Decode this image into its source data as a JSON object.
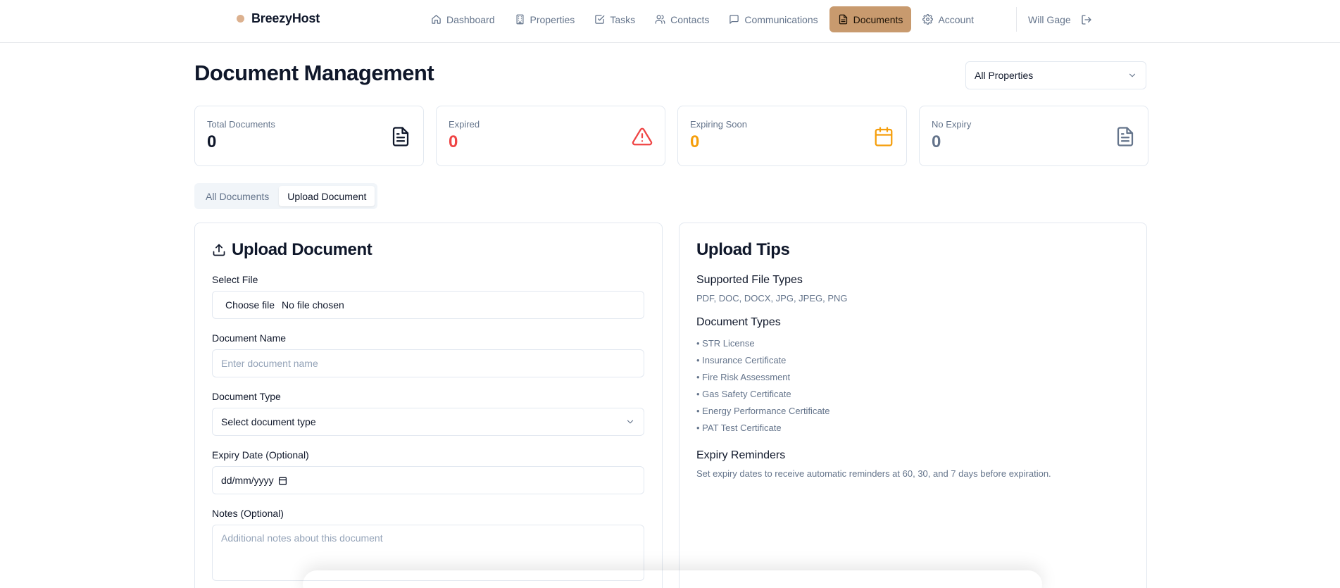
{
  "header": {
    "brand": "BreezyHost",
    "brand_color": "#dcb18f",
    "nav": [
      {
        "label": "Dashboard",
        "icon": "home-icon"
      },
      {
        "label": "Properties",
        "icon": "building-icon"
      },
      {
        "label": "Tasks",
        "icon": "check-square-icon"
      },
      {
        "label": "Contacts",
        "icon": "users-icon"
      },
      {
        "label": "Communications",
        "icon": "message-icon"
      },
      {
        "label": "Documents",
        "icon": "file-icon",
        "active": true
      },
      {
        "label": "Account",
        "icon": "gear-icon"
      }
    ],
    "user_name": "Will Gage",
    "active_color": "#c89a6e"
  },
  "page": {
    "title": "Document Management",
    "property_filter": "All Properties"
  },
  "stats": [
    {
      "label": "Total Documents",
      "value": "0",
      "color": "#0f172a",
      "icon": "file-text-icon"
    },
    {
      "label": "Expired",
      "value": "0",
      "color": "#ef4444",
      "icon": "alert-triangle-icon"
    },
    {
      "label": "Expiring Soon",
      "value": "0",
      "color": "#f59e0b",
      "icon": "calendar-icon"
    },
    {
      "label": "No Expiry",
      "value": "0",
      "color": "#64748b",
      "icon": "file-text-icon"
    }
  ],
  "tabs": [
    {
      "label": "All Documents"
    },
    {
      "label": "Upload Document",
      "active": true
    }
  ],
  "upload": {
    "title": "Upload Document",
    "file_label": "Select File",
    "file_button": "Choose file",
    "file_status": "No file chosen",
    "name_label": "Document Name",
    "name_placeholder": "Enter document name",
    "type_label": "Document Type",
    "type_value": "Select document type",
    "expiry_label": "Expiry Date (Optional)",
    "expiry_value": "dd/mm/yyyy",
    "notes_label": "Notes (Optional)",
    "notes_placeholder": "Additional notes about this document"
  },
  "tips": {
    "title": "Upload Tips",
    "file_types_heading": "Supported File Types",
    "file_types": "PDF, DOC, DOCX, JPG, JPEG, PNG",
    "doc_types_heading": "Document Types",
    "doc_types": [
      "• STR License",
      "• Insurance Certificate",
      "• Fire Risk Assessment",
      "• Gas Safety Certificate",
      "• Energy Performance Certificate",
      "• PAT Test Certificate"
    ],
    "reminders_heading": "Expiry Reminders",
    "reminders_text": "Set expiry dates to receive automatic reminders at 60, 30, and 7 days before expiration."
  }
}
